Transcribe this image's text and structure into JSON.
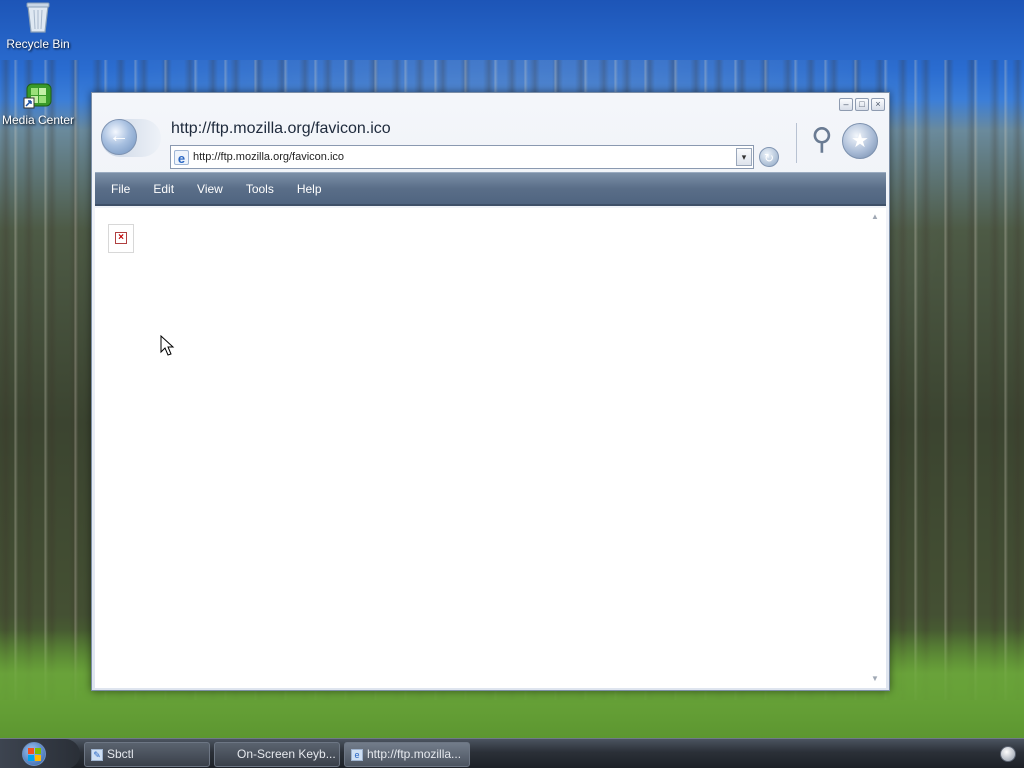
{
  "desktop": {
    "icons": [
      {
        "label": "Recycle Bin",
        "icon": "recycle-bin-icon"
      },
      {
        "label": "Media Center",
        "icon": "media-center-icon"
      }
    ]
  },
  "browser": {
    "title": "http://ftp.mozilla.org/favicon.ico",
    "address": "http://ftp.mozilla.org/favicon.ico",
    "menu": [
      "File",
      "Edit",
      "View",
      "Tools",
      "Help"
    ],
    "content": {
      "broken_image_glyph": "×"
    }
  },
  "taskbar": {
    "buttons": [
      {
        "label": "Sbctl",
        "icon": "sbctl-icon"
      },
      {
        "label": "On-Screen Keyb...",
        "icon": "keyboard-icon"
      },
      {
        "label": "http://ftp.mozilla...",
        "icon": "ie-icon"
      }
    ]
  },
  "colors": {
    "menubar": "#5a6e88",
    "taskbar": "#2b3038",
    "sky": "#1d55b7"
  }
}
